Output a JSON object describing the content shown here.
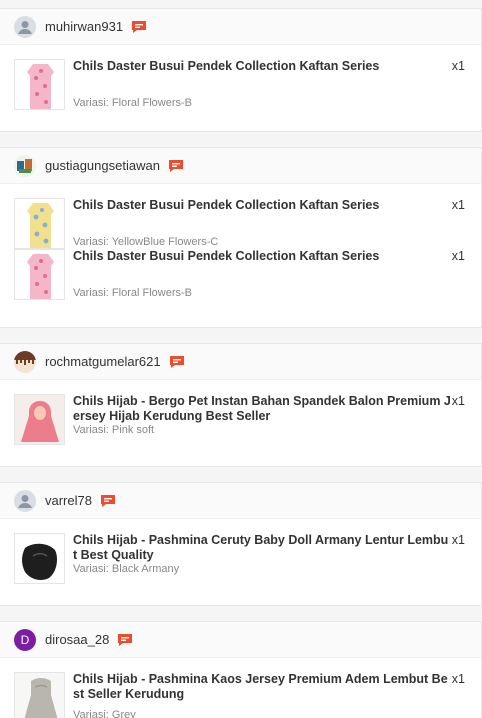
{
  "orders": [
    {
      "username": "muhirwan931",
      "avatar": "default",
      "items": [
        {
          "title": "Chils Daster Busui Pendek Collection Kaftan Series",
          "variant": "Variasi: Floral Flowers-B",
          "qty": "x1",
          "thumb_color": "#f4b6c9"
        }
      ]
    },
    {
      "username": "gustiagungsetiawan",
      "avatar": "green",
      "items": [
        {
          "title": "Chils Daster Busui Pendek Collection Kaftan Series",
          "variant": "Variasi: YellowBlue Flowers-C",
          "qty": "x1",
          "thumb_color": "#f2e08e"
        },
        {
          "title": "Chils Daster Busui Pendek Collection Kaftan Series",
          "variant": "Variasi: Floral Flowers-B",
          "qty": "x1",
          "thumb_color": "#f4b6c9"
        }
      ]
    },
    {
      "username": "rochmatgumelar621",
      "avatar": "brown",
      "items": [
        {
          "title": "Chils Hijab - Bergo Pet Instan Bahan Spandek Balon Premium Jersey Hijab Kerudung Best Seller",
          "variant": "Variasi: Pink soft",
          "qty": "x1",
          "thumb_color": "#ec7d8c"
        }
      ]
    },
    {
      "username": "varrel78",
      "avatar": "default",
      "items": [
        {
          "title": "Chils Hijab - Pashmina Ceruty Baby Doll Armany Lentur Lembut Best Quality",
          "variant": "Variasi: Black Armany",
          "qty": "x1",
          "thumb_color": "#1e1e1e"
        }
      ]
    },
    {
      "username": "dirosaa_28",
      "avatar": "letter",
      "avatar_letter": "D",
      "items": [
        {
          "title": "Chils Hijab - Pashmina Kaos Jersey Premium Adem Lembut Best Seller Kerudung",
          "variant": "Variasi: Grey",
          "qty": "x1",
          "thumb_color": "#b9b6ae"
        }
      ]
    }
  ],
  "colors": {
    "chat_icon": "#ee4d2d",
    "letter_avatar": "#7b1fa2"
  }
}
